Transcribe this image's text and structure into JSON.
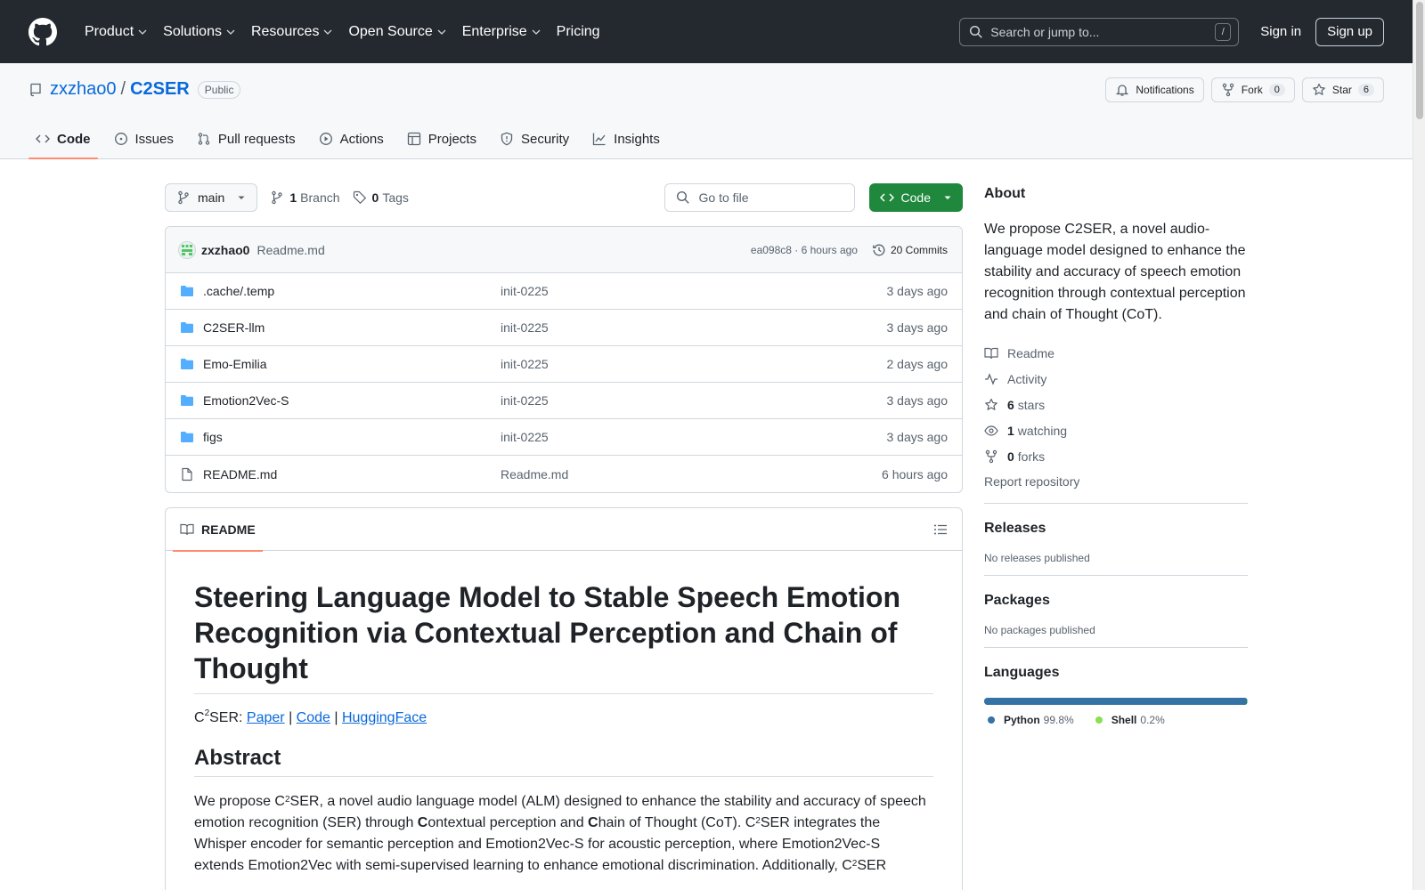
{
  "header": {
    "nav": [
      {
        "label": "Product",
        "dropdown": true
      },
      {
        "label": "Solutions",
        "dropdown": true
      },
      {
        "label": "Resources",
        "dropdown": true
      },
      {
        "label": "Open Source",
        "dropdown": true
      },
      {
        "label": "Enterprise",
        "dropdown": true
      },
      {
        "label": "Pricing",
        "dropdown": false
      }
    ],
    "search_placeholder": "Search or jump to...",
    "search_key": "/",
    "signin": "Sign in",
    "signup": "Sign up"
  },
  "repo": {
    "owner": "zxzhao0",
    "separator": "/",
    "name": "C2SER",
    "visibility": "Public",
    "notifications_label": "Notifications",
    "fork_label": "Fork",
    "fork_count": "0",
    "star_label": "Star",
    "star_count": "6",
    "tabs": [
      {
        "label": "Code",
        "icon": "code-icon",
        "active": true
      },
      {
        "label": "Issues",
        "icon": "issue-icon",
        "active": false
      },
      {
        "label": "Pull requests",
        "icon": "pull-request-icon",
        "active": false
      },
      {
        "label": "Actions",
        "icon": "play-icon",
        "active": false
      },
      {
        "label": "Projects",
        "icon": "table-icon",
        "active": false
      },
      {
        "label": "Security",
        "icon": "shield-icon",
        "active": false
      },
      {
        "label": "Insights",
        "icon": "graph-icon",
        "active": false
      }
    ]
  },
  "toolbar": {
    "branch": "main",
    "branch_count": "1",
    "branch_label": "Branch",
    "tag_count": "0",
    "tag_label": "Tags",
    "goto_placeholder": "Go to file",
    "code_button": "Code"
  },
  "latest_commit": {
    "author": "zxzhao0",
    "message": "Readme.md",
    "meta": "ea098c8 · 6 hours ago",
    "commits_label": "20 Commits"
  },
  "files": [
    {
      "name": ".cache/.temp",
      "type": "folder",
      "message": "init-0225",
      "date": "3 days ago"
    },
    {
      "name": "C2SER-llm",
      "type": "folder",
      "message": "init-0225",
      "date": "3 days ago"
    },
    {
      "name": "Emo-Emilia",
      "type": "folder",
      "message": "init-0225",
      "date": "2 days ago"
    },
    {
      "name": "Emotion2Vec-S",
      "type": "folder",
      "message": "init-0225",
      "date": "3 days ago"
    },
    {
      "name": "figs",
      "type": "folder",
      "message": "init-0225",
      "date": "3 days ago"
    },
    {
      "name": "README.md",
      "type": "file",
      "message": "Readme.md",
      "date": "6 hours ago"
    }
  ],
  "readme": {
    "tab_label": "README",
    "title": "Steering Language Model to Stable Speech Emotion Recognition via Contextual Perception and Chain of Thought",
    "links_prefix_c": "C",
    "links_prefix_sup": "2",
    "links_prefix_rest": "SER: ",
    "link_paper": "Paper",
    "link_code": "Code",
    "link_hf": "HuggingFace",
    "link_sep": " | ",
    "abstract_heading": "Abstract",
    "abstract": {
      "p1": "We propose C",
      "p2": "SER, a novel audio language model (ALM) designed to enhance the stability and accuracy of speech emotion recognition (SER) through ",
      "b1": "C",
      "p3": "ontextual perception and ",
      "b2": "C",
      "p4": "hain of Thought (CoT). C",
      "p5": "SER integrates the Whisper encoder for semantic perception and Emotion2Vec-S for acoustic perception, where Emotion2Vec-S extends Emotion2Vec with semi-supervised learning to enhance emotional discrimination. Additionally, C",
      "p6": "SER",
      "sup": "2"
    }
  },
  "about": {
    "heading": "About",
    "description": "We propose C2SER, a novel audio-language model designed to enhance the stability and accuracy of speech emotion recognition through contextual perception and chain of Thought (CoT).",
    "readme": "Readme",
    "activity": "Activity",
    "stars_count": "6",
    "stars_label": "stars",
    "watching_count": "1",
    "watching_label": "watching",
    "forks_count": "0",
    "forks_label": "forks",
    "report": "Report repository"
  },
  "releases": {
    "heading": "Releases",
    "text": "No releases published"
  },
  "packages": {
    "heading": "Packages",
    "text": "No packages published"
  },
  "languages": {
    "heading": "Languages",
    "items": [
      {
        "name": "Python",
        "percent": "99.8%",
        "fraction": 0.998,
        "color": "#3572a5"
      },
      {
        "name": "Shell",
        "percent": "0.2%",
        "fraction": 0.002,
        "color": "#89e051"
      }
    ]
  }
}
